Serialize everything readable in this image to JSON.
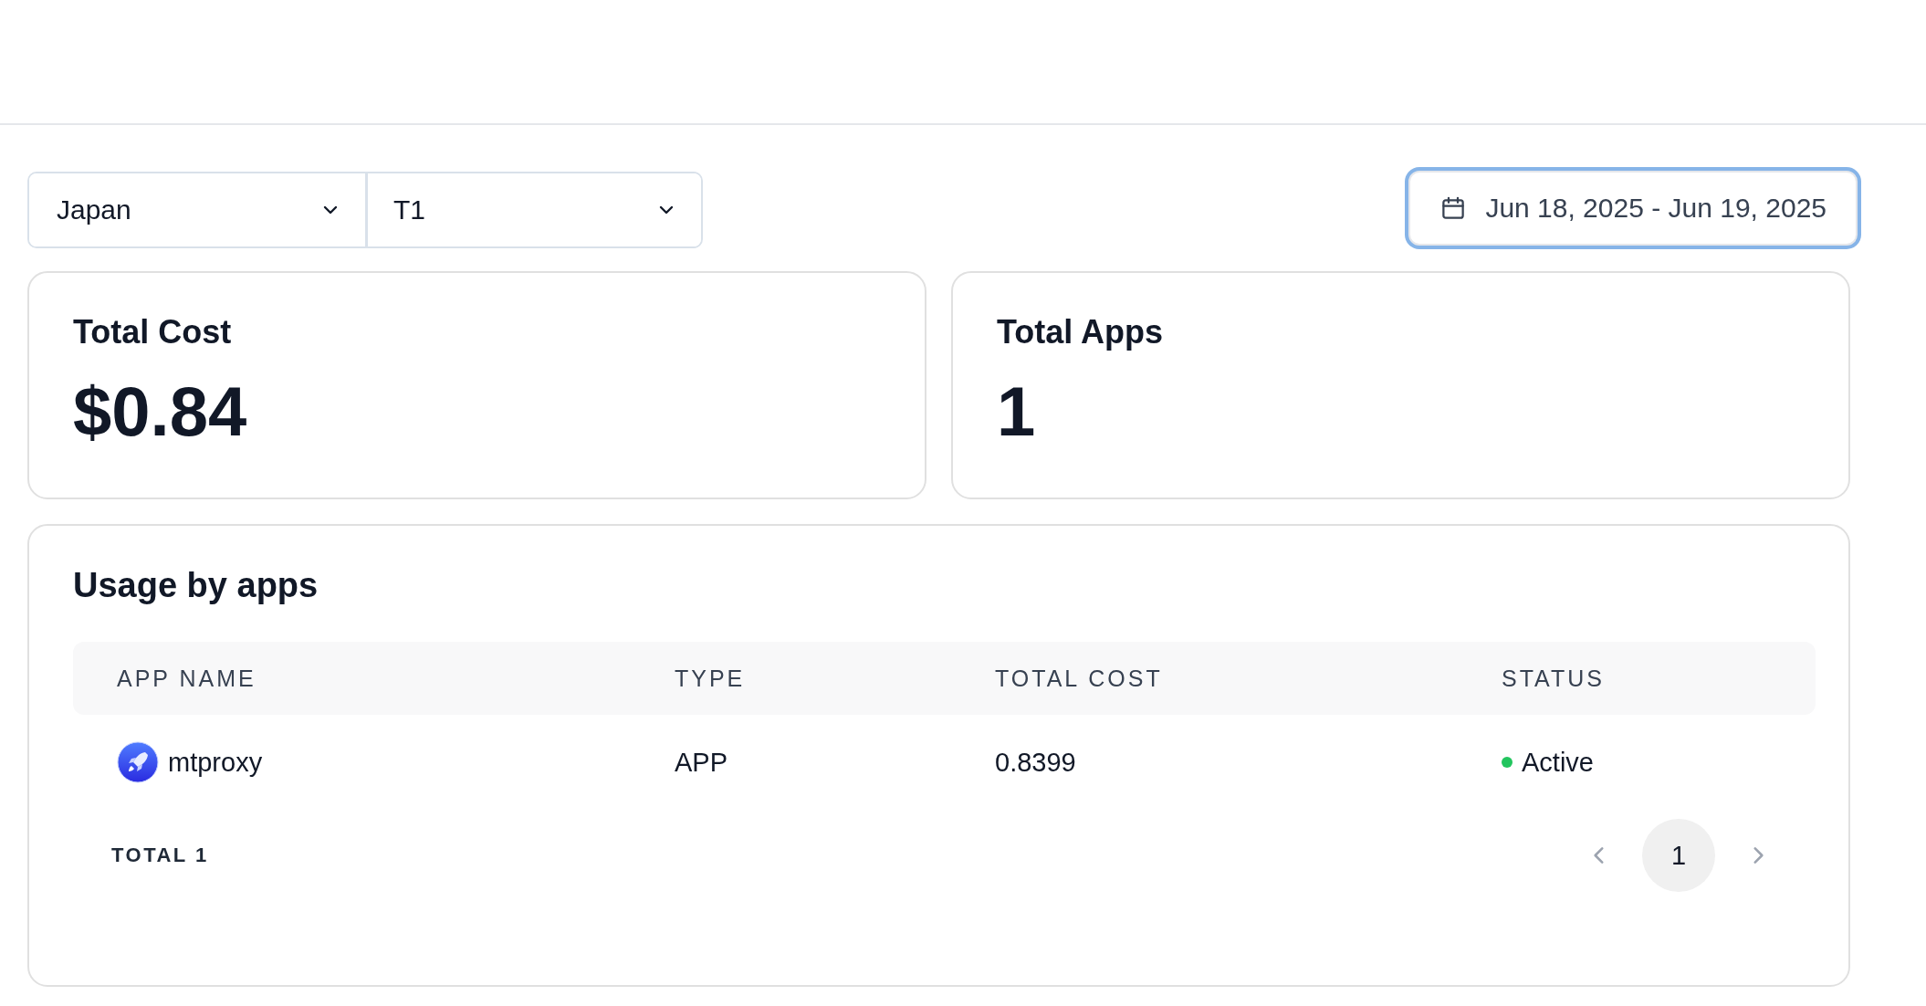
{
  "filters": [
    {
      "kind": "select",
      "value": "Japan"
    },
    {
      "kind": "select",
      "value": "T1"
    }
  ],
  "date_range": {
    "value": "Jun 18, 2025 - Jun 19, 2025",
    "focused": true
  },
  "stats": [
    {
      "title": "Total Cost",
      "value": "$0.84"
    },
    {
      "title": "Total Apps",
      "value": "1"
    }
  ],
  "usage": {
    "title": "Usage by apps",
    "table": {
      "columns": [
        "APP NAME",
        "TYPE",
        "TOTAL COST",
        "STATUS"
      ],
      "rows": [
        {
          "app_name": "mtproxy",
          "type": "APP",
          "total_cost": "0.8399",
          "status": "Active",
          "color": "#22c55e"
        }
      ]
    },
    "total": "TOTAL 1",
    "pages": [
      {
        "label": "1",
        "selected": true
      }
    ]
  }
}
